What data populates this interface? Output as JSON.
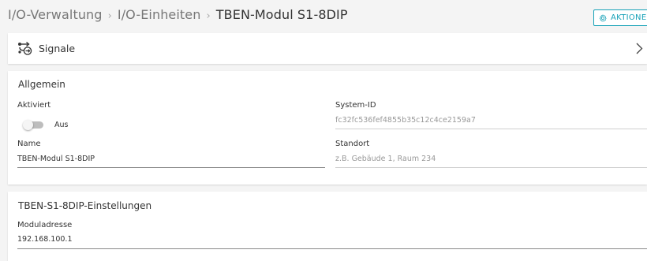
{
  "breadcrumb": {
    "items": [
      "I/O-Verwaltung",
      "I/O-Einheiten"
    ],
    "separator": "›",
    "current": "TBEN-Modul S1-8DIP"
  },
  "header": {
    "actions_label": "AKTIONEN",
    "accent_color": "#17a2b8"
  },
  "signals": {
    "label": "Signale",
    "icon": "signals-icon"
  },
  "general": {
    "title": "Allgemein",
    "activated_label": "Aktiviert",
    "toggle_state_label": "Aus",
    "toggle_on": false,
    "system_id_label": "System-ID",
    "system_id_value": "fc32fc536fef4855b35c12c4ce2159a7",
    "name_label": "Name",
    "name_value": "TBEN-Modul S1-8DIP",
    "location_label": "Standort",
    "location_placeholder": "z.B. Gebäude 1, Raum 234"
  },
  "settings": {
    "title": "TBEN-S1-8DIP-Einstellungen",
    "module_address_label": "Moduladresse",
    "module_address_value": "192.168.100.1"
  }
}
